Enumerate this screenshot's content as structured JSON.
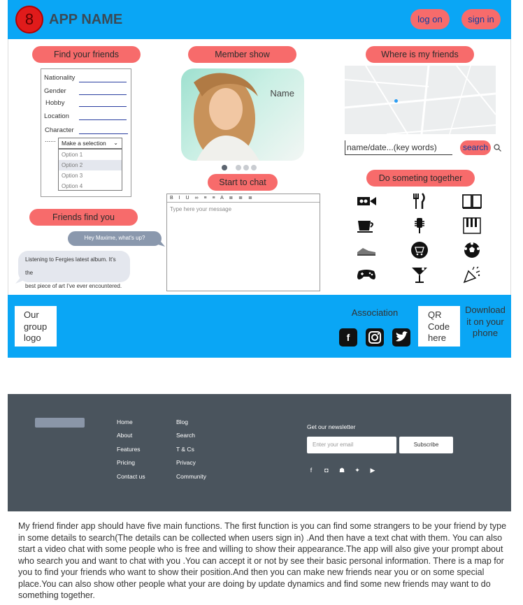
{
  "header": {
    "logo_text": "8",
    "app_name": "APP NAME",
    "log_on": "log on",
    "sign_in": "sign in"
  },
  "find_friends": {
    "title": "Find your friends",
    "fields": [
      "Nationality",
      "Gender",
      "Hobby",
      "Location",
      "Character"
    ],
    "dots": "......",
    "select_placeholder": "Make a selection",
    "options": [
      "Option 1",
      "Option 2",
      "Option 3",
      "Option 4"
    ],
    "selected_option": "Option 2"
  },
  "member_show": {
    "title": "Member show",
    "photo_name": "Name"
  },
  "map_section": {
    "title": "Where is my friends",
    "search_value": "name/date...(key words)",
    "search_button": "search"
  },
  "friends_find_you": {
    "title": "Friends find you",
    "message_out": "Hey Maxime, what's up?",
    "message_in_1": "Listening to Fergies latest album. It's the",
    "message_in_2": "best piece of art I've ever encountered."
  },
  "chat": {
    "title": "Start to chat",
    "toolbar": "B I U ∞ ≡ ≡ A ≣ ≣ ≣",
    "placeholder": "Type here your message"
  },
  "together": {
    "title": "Do someting together",
    "icons": [
      "video-camera-icon",
      "fork-knife-icon",
      "book-icon",
      "coffee-cup-icon",
      "microphone-icon",
      "piano-icon",
      "sneaker-icon",
      "shopping-cart-icon",
      "soccer-ball-icon",
      "gamepad-icon",
      "cocktail-icon",
      "party-popper-icon"
    ]
  },
  "band": {
    "group_logo": "Our group logo",
    "association": "Association",
    "qr_code": "QR Code here",
    "download": "Download it on your phone"
  },
  "footer": {
    "col1": [
      "Home",
      "About",
      "Features",
      "Pricing",
      "Contact us"
    ],
    "col2": [
      "Blog",
      "Search",
      "T & Cs",
      "Privacy",
      "Community"
    ],
    "newsletter_title": "Get our newsletter",
    "email_placeholder": "Enter your email",
    "subscribe": "Subscribe"
  },
  "description": "My friend finder app should have five main functions. The first function is you can find some strangers to be your friend by type in some details to search(The details can be collected when users sign in) .And then have a text chat with them. You can also start a video chat with some people who is free and willing to show their appearance.The app will also give your prompt about who search you and want to chat with you .You can accept it or not by see their basic personal information. There is a  map for you to find your friends who want to show their position.And then you can make new friends near you or on some special place.You can also show other people what your are doing by update dynamics and find some new friends may want to do something together.",
  "colors": {
    "header_blue": "#0aa6f5",
    "pill_red": "#f76b6b",
    "footer_gray": "#4a545d"
  }
}
